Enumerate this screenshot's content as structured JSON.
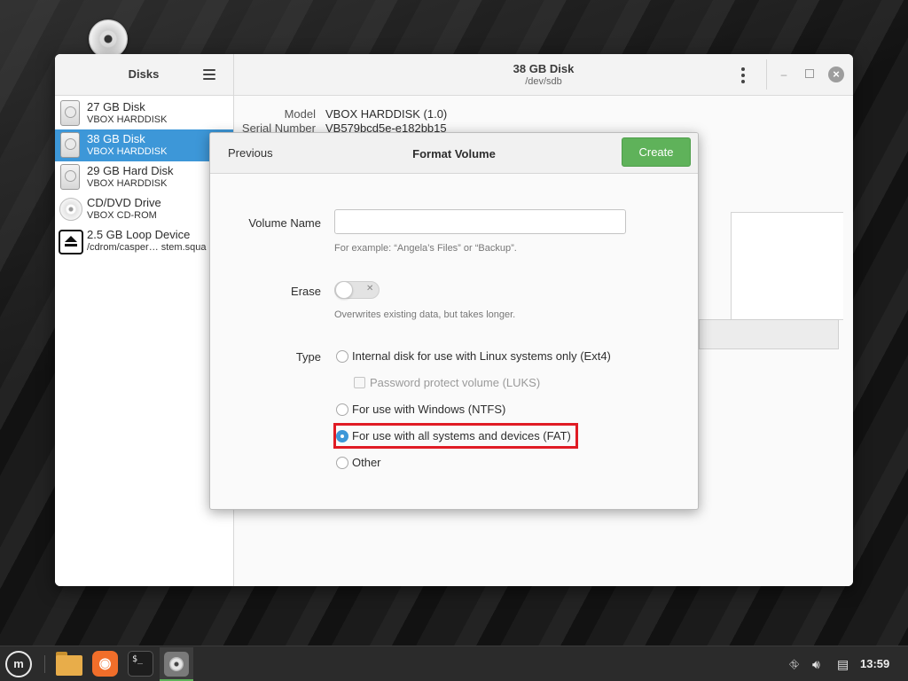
{
  "window": {
    "sidebar_title": "Disks",
    "title": "38 GB Disk",
    "subtitle": "/dev/sdb",
    "minimize_glyph": "–",
    "close_glyph": "×"
  },
  "disks": [
    {
      "name": "27 GB Disk",
      "sub": "VBOX HARDDISK",
      "icon": "harddisk-icon"
    },
    {
      "name": "38 GB Disk",
      "sub": "VBOX HARDDISK",
      "icon": "harddisk-icon",
      "selected": true
    },
    {
      "name": "29 GB Hard Disk",
      "sub": "VBOX HARDDISK",
      "icon": "harddisk-icon"
    },
    {
      "name": "CD/DVD Drive",
      "sub": "VBOX CD-ROM",
      "icon": "cd-icon"
    },
    {
      "name": "2.5 GB Loop Device",
      "sub": "/cdrom/casper… stem.squa",
      "icon": "eject-icon"
    }
  ],
  "info": {
    "model_label": "Model",
    "model_value": "VBOX HARDDISK (1.0)",
    "serial_label": "Serial Number",
    "serial_value": "VB579bcd5e-e182bb15"
  },
  "dialog": {
    "previous_label": "Previous",
    "title": "Format Volume",
    "create_label": "Create",
    "volume_name_label": "Volume Name",
    "volume_name_value": "",
    "volume_name_hint": "For example: “Angela’s Files” or “Backup”.",
    "erase_label": "Erase",
    "erase_on": false,
    "erase_hint": "Overwrites existing data, but takes longer.",
    "type_label": "Type",
    "options": {
      "ext4": "Internal disk for use with Linux systems only (Ext4)",
      "luks": "Password protect volume (LUKS)",
      "ntfs": "For use with Windows (NTFS)",
      "fat": "For use with all systems and devices (FAT)",
      "other": "Other"
    },
    "selected_option": "fat"
  },
  "taskbar": {
    "clock": "13:59",
    "terminal_glyph": "$_",
    "firefox_glyph": "◉"
  },
  "colors": {
    "accent": "#3d97d8",
    "create_button": "#5fb25a",
    "highlight": "#e01b24"
  }
}
